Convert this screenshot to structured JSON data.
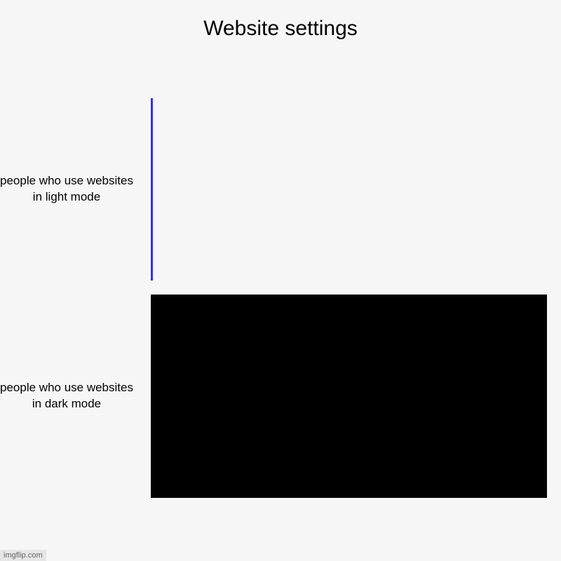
{
  "chart_data": {
    "type": "bar",
    "orientation": "horizontal",
    "title": "Website settings",
    "categories": [
      "people who use websites in light mode",
      "people who use websites in dark mode"
    ],
    "values": [
      0.6,
      100
    ],
    "series_colors": [
      "#2f2fff",
      "#000000"
    ],
    "xlabel": "",
    "ylabel": "",
    "xlim": [
      0,
      100
    ]
  },
  "watermark": "imgflip.com"
}
